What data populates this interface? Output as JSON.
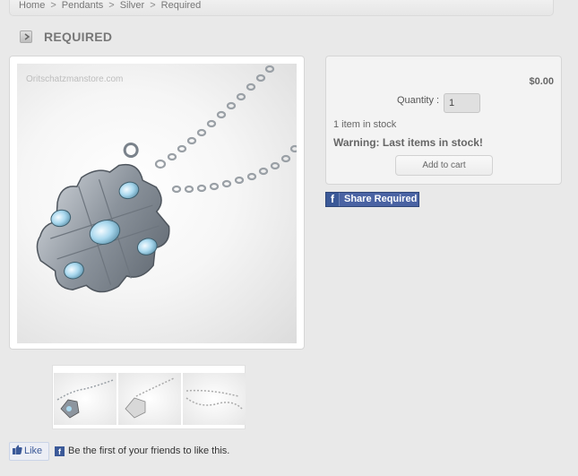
{
  "breadcrumb": {
    "items": [
      "Home",
      "Pendants",
      "Silver",
      "Required"
    ],
    "separator": ">"
  },
  "product": {
    "title": "REQUIRED",
    "watermark": "Oritschatzmanstore.com"
  },
  "buy": {
    "price": "$0.00",
    "quantity_label": "Quantity :",
    "quantity_value": "1",
    "stock_text": "1 item in stock",
    "warning": "Warning: Last items in stock!",
    "add_to_cart": "Add to cart"
  },
  "share": {
    "label": "Share Required"
  },
  "facebook": {
    "like_label": "Like",
    "like_prompt": "Be the first of your friends to like this."
  },
  "icons": {
    "title_arrow": "chevron-right-icon",
    "facebook": "facebook-icon",
    "thumbs_up": "thumbs-up-icon"
  },
  "colors": {
    "facebook_blue": "#3b5998",
    "share_button": "#4a63a3",
    "page_background": "#e9e9e9"
  }
}
